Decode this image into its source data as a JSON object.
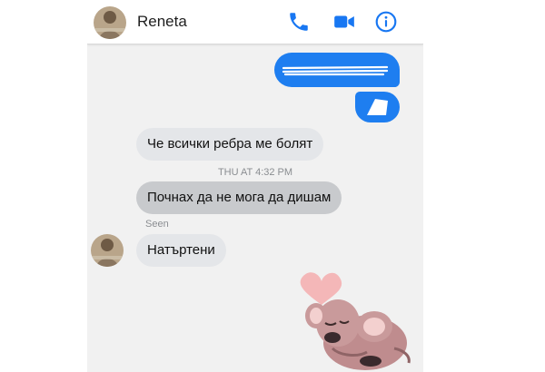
{
  "header": {
    "contact_name": "Reneta",
    "icons": [
      "avatar",
      "phone-icon",
      "video-icon",
      "info-icon"
    ],
    "accent": "#1877f2"
  },
  "messages": [
    {
      "text": "Че всички ребра ме болят",
      "side": "incoming"
    },
    {
      "text": "Почнах да не мога да дишам",
      "side": "incoming"
    },
    {
      "text": "Натъртени",
      "side": "incoming"
    }
  ],
  "timestamp": "THU AT 4:32 PM",
  "seen_label": "Seen",
  "colors": {
    "outgoing_bubble": "#1e7ef0",
    "incoming_bubble": "#e4e6e9",
    "chat_bg": "#f1f1f1"
  }
}
